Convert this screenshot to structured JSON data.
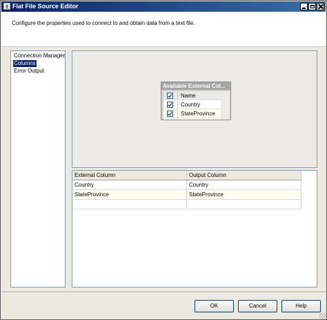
{
  "window": {
    "title": "Flat File Source Editor",
    "icon": "document-icon"
  },
  "header": {
    "description": "Configure the properties used to connect to and obtain data from a text file."
  },
  "nav": {
    "items": [
      {
        "label": "Connection Manager",
        "selected": false
      },
      {
        "label": "Columns",
        "selected": true
      },
      {
        "label": "Error Output",
        "selected": false
      }
    ]
  },
  "available_columns": {
    "title": "Available External Col...",
    "header_label": "Name",
    "rows": [
      {
        "name": "Country",
        "checked": true
      },
      {
        "name": "StateProvince",
        "checked": true
      }
    ]
  },
  "mapping_grid": {
    "columns": [
      "External Column",
      "Output Column"
    ],
    "rows": [
      [
        "Country",
        "Country"
      ],
      [
        "StateProvince",
        "StateProvince"
      ]
    ]
  },
  "buttons": {
    "ok": "OK",
    "cancel": "Cancel",
    "help": "Help"
  },
  "colors": {
    "title_bar": "#0a246a",
    "selection": "#0a246a",
    "row_highlight": "#fffff0"
  }
}
